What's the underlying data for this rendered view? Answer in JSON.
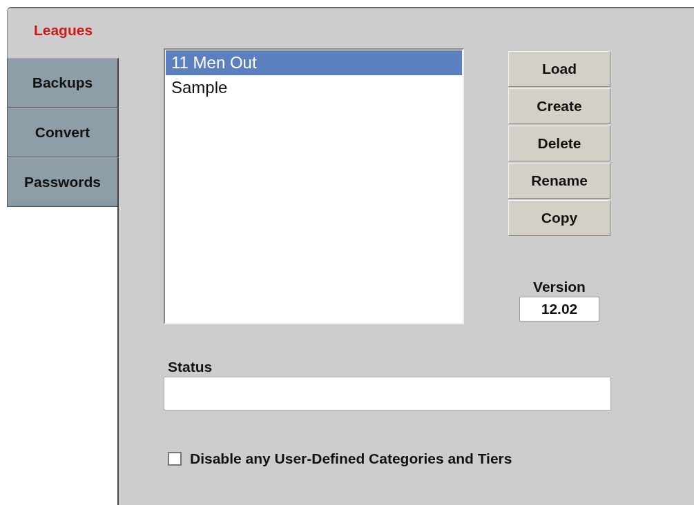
{
  "tabs": [
    {
      "label": "Leagues",
      "selected": true
    },
    {
      "label": "Backups",
      "selected": false
    },
    {
      "label": "Convert",
      "selected": false
    },
    {
      "label": "Passwords",
      "selected": false
    }
  ],
  "leagues_list": {
    "items": [
      {
        "label": "11 Men Out",
        "selected": true
      },
      {
        "label": "Sample",
        "selected": false
      }
    ]
  },
  "buttons": [
    "Load",
    "Create",
    "Delete",
    "Rename",
    "Copy"
  ],
  "version": {
    "label": "Version",
    "value": "12.02"
  },
  "status": {
    "label": "Status"
  },
  "disable_option": {
    "label": "Disable any User-Defined Categories and Tiers",
    "checked": false
  }
}
